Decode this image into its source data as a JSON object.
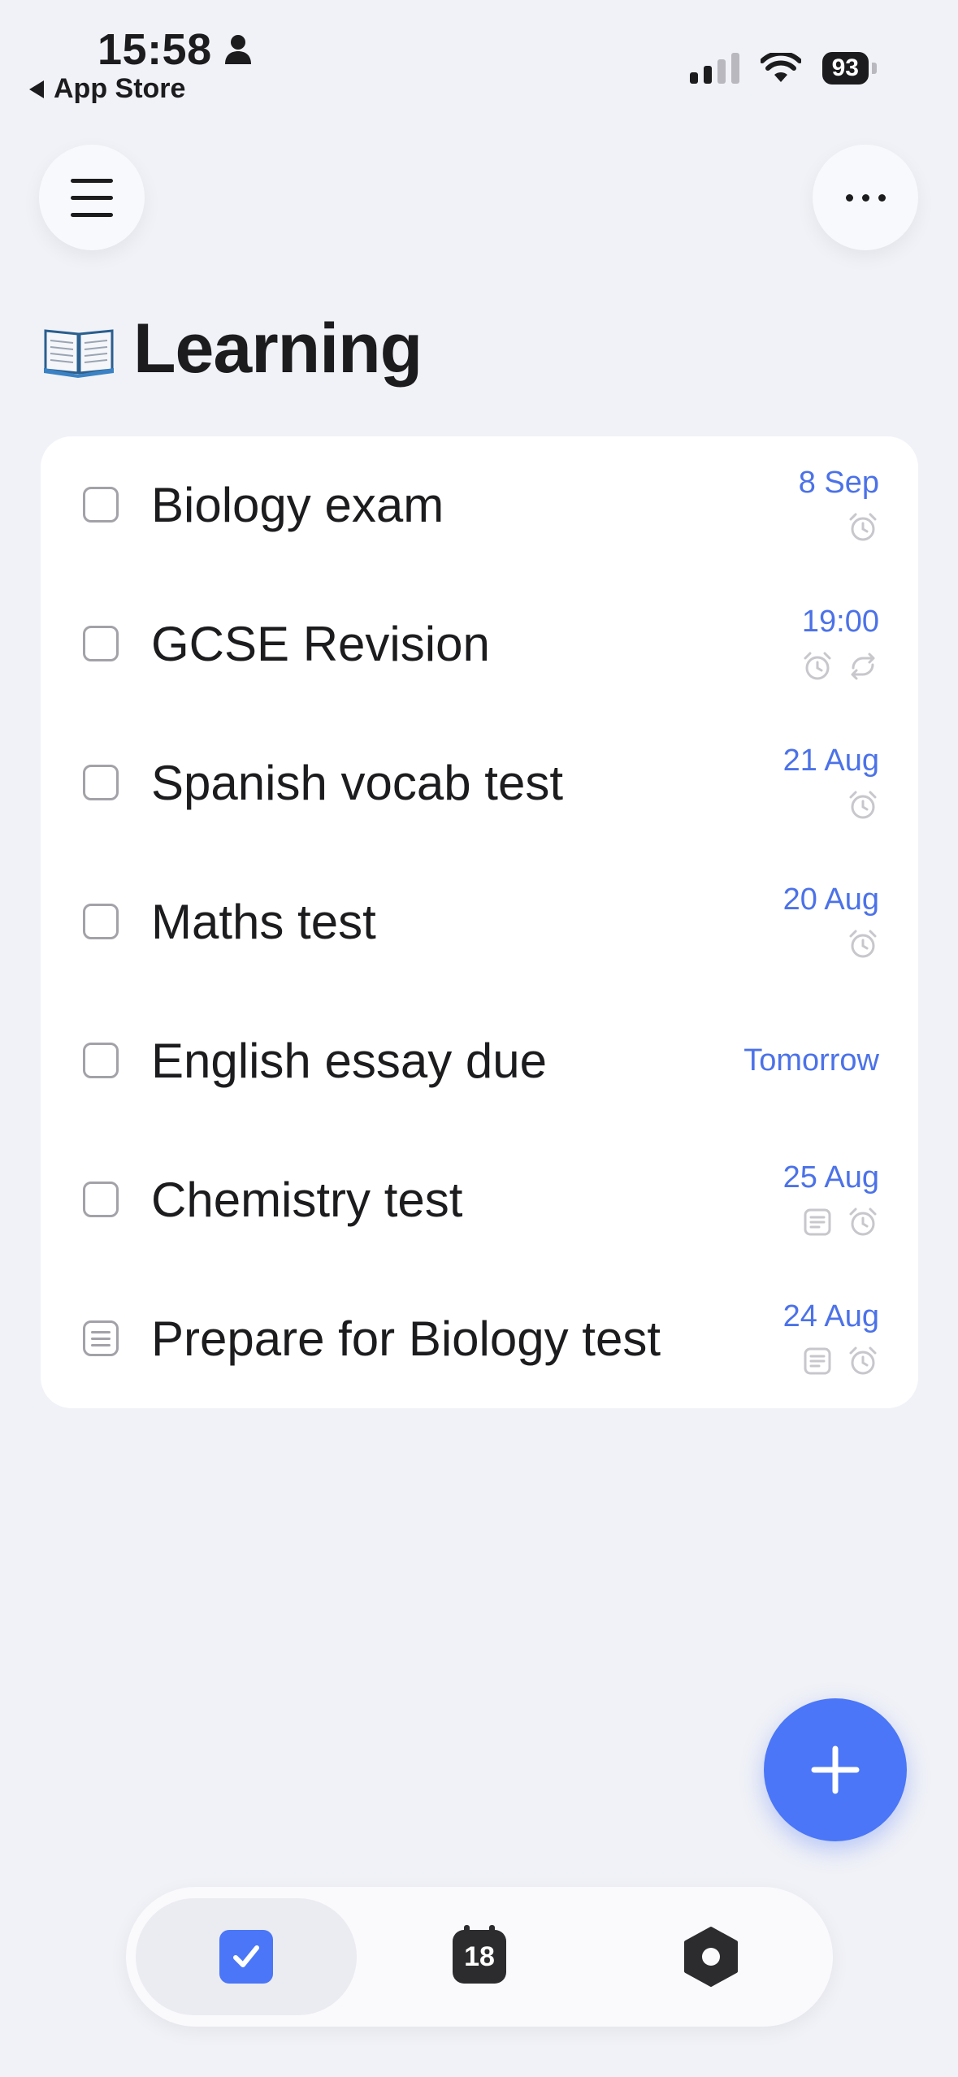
{
  "status_bar": {
    "time": "15:58",
    "back_label": "App Store",
    "battery": "93"
  },
  "header": {
    "menu_icon": "hamburger-icon",
    "more_icon": "ellipsis-icon"
  },
  "list": {
    "emoji": "open-book-icon",
    "title": "Learning"
  },
  "tasks": [
    {
      "title": "Biology exam",
      "date": "8 Sep",
      "type": "checkbox",
      "icons": [
        "alarm"
      ]
    },
    {
      "title": "GCSE Revision",
      "date": "19:00",
      "type": "checkbox",
      "icons": [
        "alarm",
        "repeat"
      ]
    },
    {
      "title": "Spanish vocab test",
      "date": "21 Aug",
      "type": "checkbox",
      "icons": [
        "alarm"
      ]
    },
    {
      "title": "Maths test",
      "date": "20 Aug",
      "type": "checkbox",
      "icons": [
        "alarm"
      ]
    },
    {
      "title": "English essay due",
      "date": "Tomorrow",
      "type": "checkbox",
      "icons": []
    },
    {
      "title": "Chemistry test",
      "date": "25 Aug",
      "type": "checkbox",
      "icons": [
        "note",
        "alarm"
      ]
    },
    {
      "title": "Prepare for Biology test",
      "date": "24 Aug",
      "type": "note",
      "icons": [
        "note",
        "alarm"
      ]
    }
  ],
  "tab_bar": {
    "active": "tasks",
    "calendar_day": "18"
  },
  "colors": {
    "accent": "#4a76f7",
    "date_text": "#4c72e8",
    "background": "#f1f2f7"
  }
}
